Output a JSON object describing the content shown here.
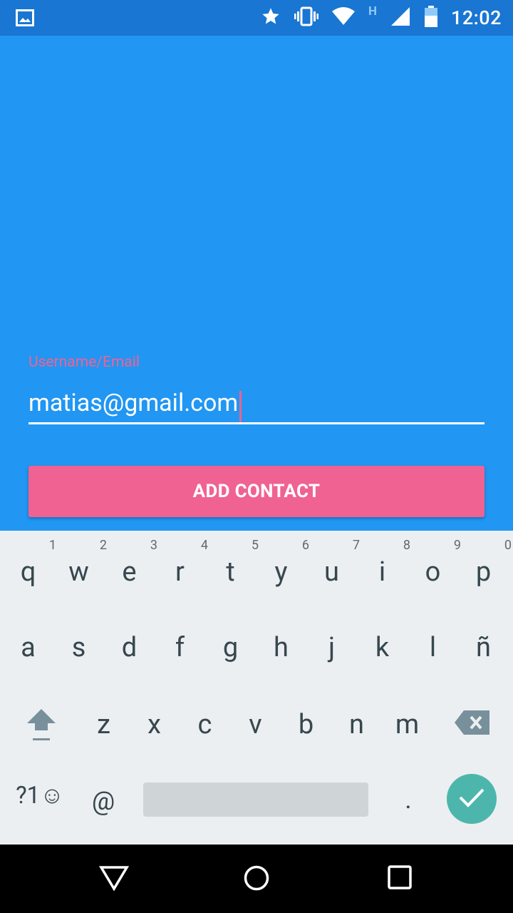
{
  "status_bar": {
    "time": "12:02",
    "network_type": "H",
    "icons": [
      "image-icon",
      "star-icon",
      "vibrate-icon",
      "wifi-icon",
      "signal-icon",
      "battery-icon"
    ]
  },
  "form": {
    "label": "Username/Email",
    "value": "matias@gmail.com",
    "button_label": "ADD CONTACT"
  },
  "keyboard": {
    "row1": [
      {
        "k": "q",
        "h": "1"
      },
      {
        "k": "w",
        "h": "2"
      },
      {
        "k": "e",
        "h": "3"
      },
      {
        "k": "r",
        "h": "4"
      },
      {
        "k": "t",
        "h": "5"
      },
      {
        "k": "y",
        "h": "6"
      },
      {
        "k": "u",
        "h": "7"
      },
      {
        "k": "i",
        "h": "8"
      },
      {
        "k": "o",
        "h": "9"
      },
      {
        "k": "p",
        "h": "0"
      }
    ],
    "row2": [
      "a",
      "s",
      "d",
      "f",
      "g",
      "h",
      "j",
      "k",
      "l",
      "ñ"
    ],
    "row3": [
      "z",
      "x",
      "c",
      "v",
      "b",
      "n",
      "m"
    ],
    "symbols_label": "?1☺",
    "at_label": "@",
    "period_label": "."
  },
  "colors": {
    "status_bar": "#1976D2",
    "primary": "#2196F3",
    "accent": "#F06292",
    "enter": "#4DB6AC"
  }
}
